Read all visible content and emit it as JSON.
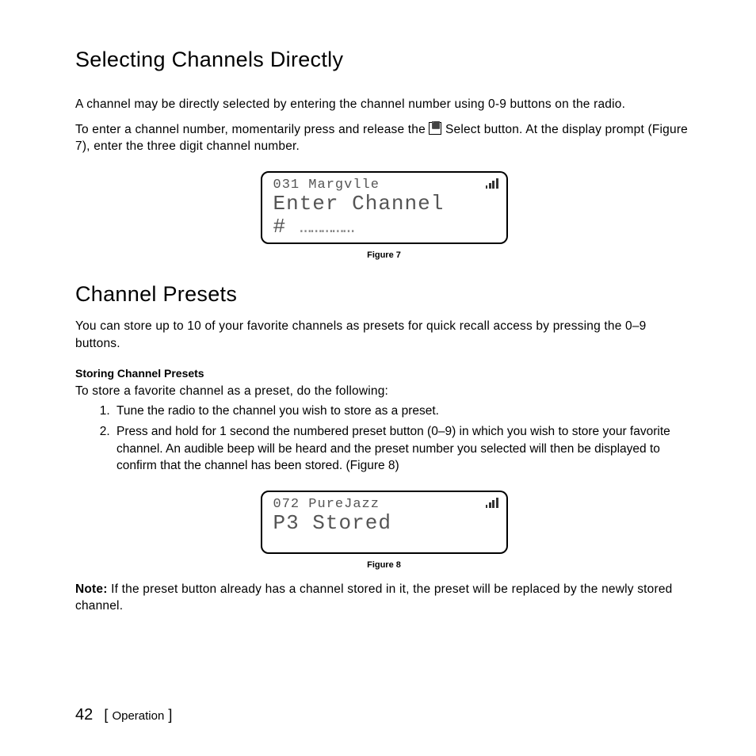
{
  "section1": {
    "title": "Selecting Channels Directly",
    "p1": "A channel may be directly selected by entering the channel number using 0-9 buttons on the radio.",
    "p2a": "To enter a channel number, momentarily press and release the ",
    "p2b": " Select button. At the display prompt (Figure 7), enter the three digit channel number."
  },
  "fig7": {
    "top": "031 Margvlle",
    "line1": "Enter Channel",
    "line2": "# ",
    "caption": "Figure 7"
  },
  "section2": {
    "title": "Channel Presets",
    "p1": "You can store up to 10 of your favorite channels as presets for quick recall access by pressing the 0–9 buttons.",
    "sub": "Storing Channel Presets",
    "p2": "To store a favorite channel as a preset, do the following:",
    "step1": "Tune the radio to the channel you wish to store as a preset.",
    "step2": "Press and hold for 1 second the numbered preset button (0–9) in which you wish to store your favorite channel. An audible beep will be heard and the preset number you selected will then be displayed to confirm that the channel has been stored. (Figure 8)"
  },
  "fig8": {
    "top": "072 PureJazz",
    "line1": "P3 Stored",
    "caption": "Figure 8"
  },
  "note": {
    "label": "Note:",
    "text": " If the preset button already has a channel stored in it, the preset will be replaced by the newly stored channel."
  },
  "footer": {
    "page": "42",
    "section": "Operation"
  }
}
